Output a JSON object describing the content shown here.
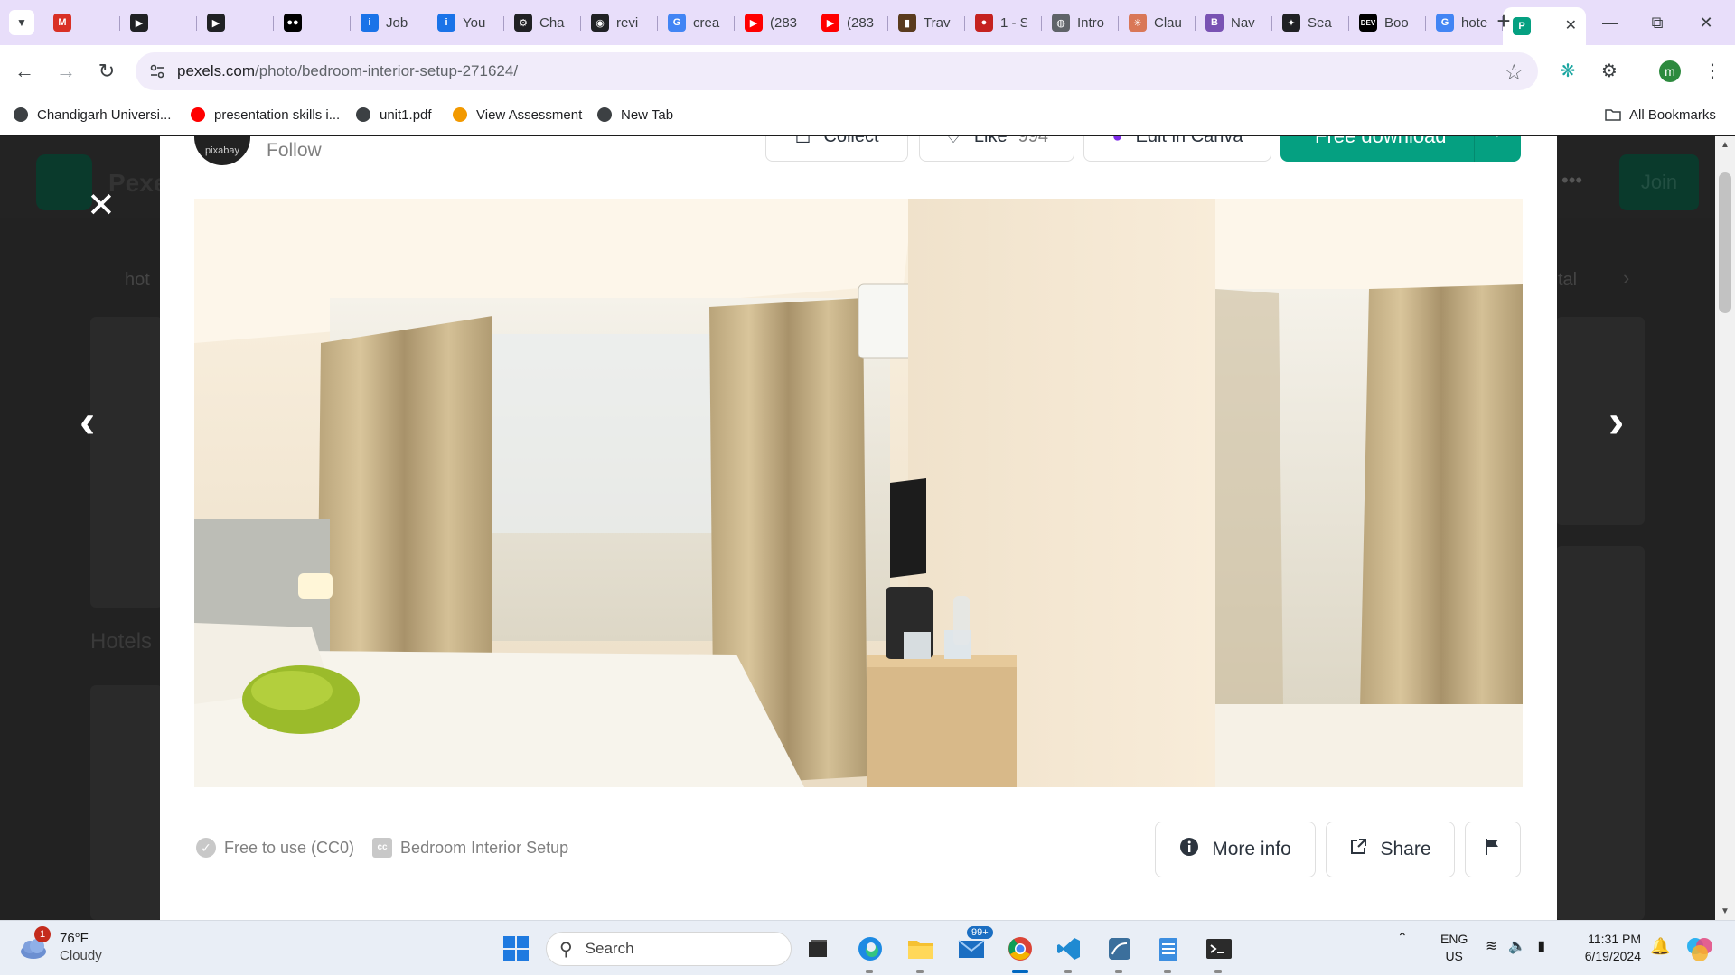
{
  "browser": {
    "tabs": [
      {
        "title": "",
        "icon": "gmail-icon",
        "color": "#d93025",
        "glyph": "M"
      },
      {
        "title": "",
        "icon": "youtube-play-icon",
        "color": "#202124",
        "glyph": "▶"
      },
      {
        "title": "",
        "icon": "youtube-play-icon",
        "color": "#202124",
        "glyph": "▶"
      },
      {
        "title": "",
        "icon": "medium-icon",
        "color": "#000000",
        "glyph": "●●"
      },
      {
        "title": "Job",
        "icon": "info-icon",
        "color": "#1a73e8",
        "glyph": "i"
      },
      {
        "title": "You",
        "icon": "info-icon",
        "color": "#1a73e8",
        "glyph": "i"
      },
      {
        "title": "Cha",
        "icon": "openai-icon",
        "color": "#202124",
        "glyph": "⚙"
      },
      {
        "title": "revi",
        "icon": "github-icon",
        "color": "#202124",
        "glyph": "◉"
      },
      {
        "title": "crea",
        "icon": "google-icon",
        "color": "#4285f4",
        "glyph": "G"
      },
      {
        "title": "(283",
        "icon": "youtube-icon",
        "color": "#ff0000",
        "glyph": "▶"
      },
      {
        "title": "(283",
        "icon": "youtube-icon",
        "color": "#ff0000",
        "glyph": "▶"
      },
      {
        "title": "Trav",
        "icon": "travel-icon",
        "color": "#5a3b1e",
        "glyph": "▮"
      },
      {
        "title": "1 - S",
        "icon": "rail-icon",
        "color": "#c5221f",
        "glyph": "●"
      },
      {
        "title": "Intro",
        "icon": "globe-icon",
        "color": "#5f6368",
        "glyph": "◍"
      },
      {
        "title": "Clau",
        "icon": "claude-icon",
        "color": "#d97757",
        "glyph": "✳"
      },
      {
        "title": "Nav",
        "icon": "bootstrap-icon",
        "color": "#7952b3",
        "glyph": "B"
      },
      {
        "title": "Sea",
        "icon": "perplexity-icon",
        "color": "#202124",
        "glyph": "✦"
      },
      {
        "title": "Boo",
        "icon": "dev-icon",
        "color": "#000000",
        "glyph": "DEV"
      },
      {
        "title": "hote",
        "icon": "google-icon",
        "color": "#4285f4",
        "glyph": "G"
      },
      {
        "title": "",
        "icon": "pexels-icon",
        "color": "#05a081",
        "glyph": "P",
        "active": true
      }
    ],
    "url_host": "pexels.com",
    "url_path": "/photo/bedroom-interior-setup-271624/",
    "profile_initial": "m",
    "bookmarks": [
      {
        "label": "Chandigarh Universi...",
        "icon": "globe-icon"
      },
      {
        "label": "presentation skills i...",
        "icon": "youtube-icon"
      },
      {
        "label": "unit1.pdf",
        "icon": "globe-icon"
      },
      {
        "label": "View Assessment",
        "icon": "assessment-icon"
      },
      {
        "label": "New Tab",
        "icon": "globe-icon"
      }
    ],
    "all_bookmarks": "All Bookmarks"
  },
  "backdrop": {
    "brand": "Pexe",
    "join": "Join",
    "chip_left": "hot",
    "chip_right": "tal",
    "caption": "Hotels"
  },
  "modal": {
    "author_logo_text": "pixabay",
    "follow": "Follow",
    "collect": "Collect",
    "like": "Like",
    "like_count": "994",
    "edit_canva": "Edit in Canva",
    "free_download": "Free download",
    "license": "Free to use (CC0)",
    "photo_title": "Bedroom Interior Setup",
    "more_info": "More info",
    "share": "Share"
  },
  "taskbar": {
    "temp": "76°F",
    "condition": "Cloudy",
    "weather_badge": "1",
    "search_placeholder": "Search",
    "mail_badge": "99+",
    "lang": "ENG",
    "region": "US",
    "time": "11:31 PM",
    "date": "6/19/2024"
  },
  "colors": {
    "accent": "#05a081",
    "tabstrip": "#e8defa",
    "backdrop": "#222222"
  }
}
